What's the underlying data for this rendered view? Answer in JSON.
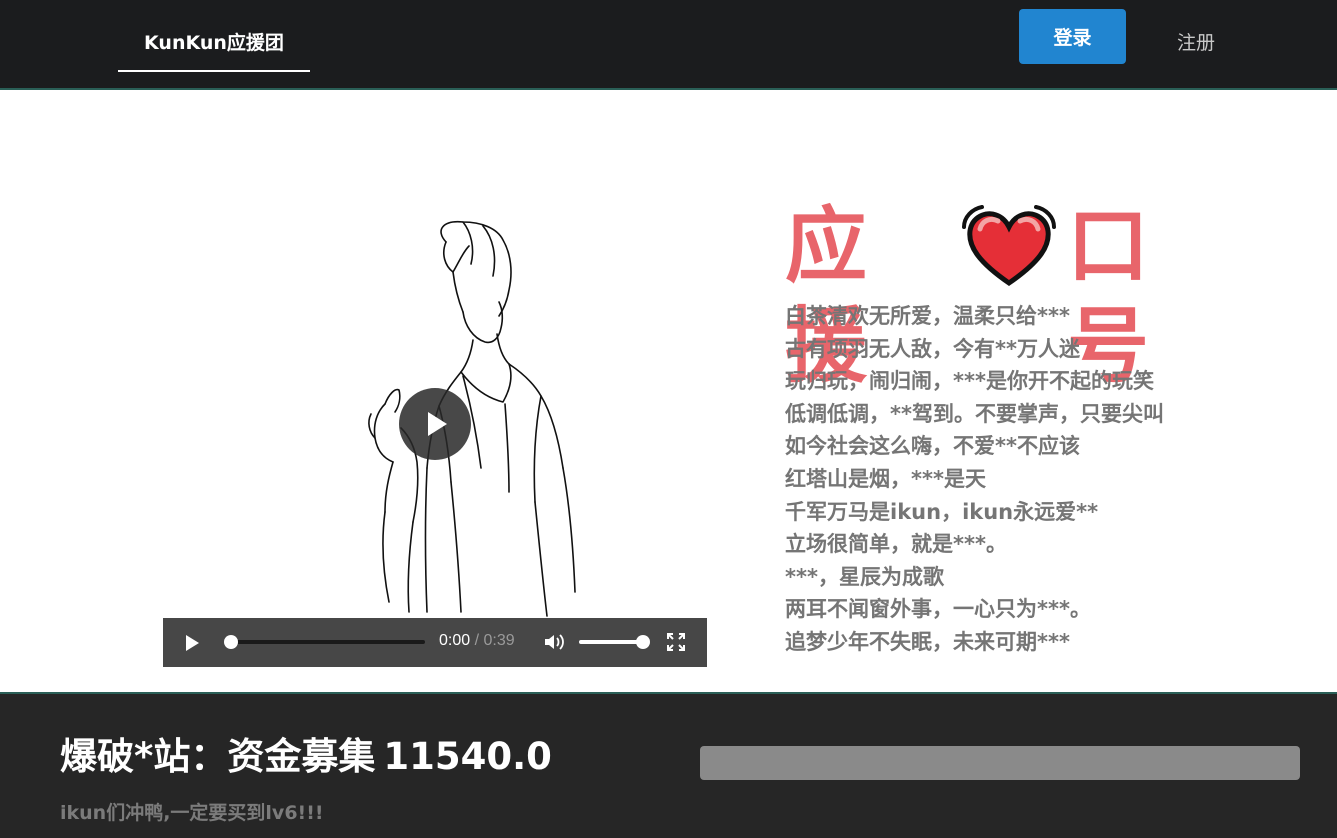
{
  "nav": {
    "brand": "KunKun应援团",
    "login": "登录",
    "register": "注册"
  },
  "video": {
    "current_time": "0:00",
    "separator": " / ",
    "duration": "0:39",
    "progress": 0.0,
    "volume": 1.0,
    "icons": [
      "play-icon",
      "volume-icon",
      "fullscreen-icon"
    ]
  },
  "slogan": {
    "title_left": "应援",
    "title_right": "口号",
    "heart_icon": "heart-icon",
    "lines": [
      "白茶清欢无所爱，温柔只给***",
      "古有项羽无人敌，今有**万人迷",
      "玩归玩，闹归闹，***是你开不起的玩笑",
      "低调低调，**驾到。不要掌声，只要尖叫",
      "如今社会这么嗨，不爱**不应该",
      "红塔山是烟，***是天",
      "千军万马是ikun，ikun永远爱**",
      "立场很简单，就是***。",
      "***，星辰为成歌",
      "两耳不闻窗外事，一心只为***。",
      "追梦少年不失眠，未来可期***"
    ]
  },
  "fund": {
    "label": "爆破*站：资金募集",
    "amount": "11540.0",
    "subtitle": "ikun们冲鸭,一定要买到lv6!!!",
    "progress": 0
  },
  "colors": {
    "nav_bg": "#1b1c1e",
    "login_btn": "#2185d0",
    "slogan_title": "#e8656b",
    "slogan_text": "#757575",
    "footer_bg": "#262626",
    "progress_track": "#8a8a8a"
  }
}
